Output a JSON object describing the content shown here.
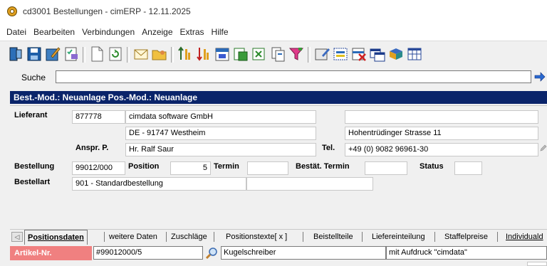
{
  "window": {
    "title": "cd3001 Bestellungen - cimERP - 12.11.2025"
  },
  "menu": [
    "Datei",
    "Bearbeiten",
    "Verbindungen",
    "Anzeige",
    "Extras",
    "Hilfe"
  ],
  "search": {
    "label": "Suche",
    "value": ""
  },
  "mode_bar": "Best.-Mod.: Neuanlage Pos.-Mod.: Neuanlage",
  "form": {
    "lieferant_label": "Lieferant",
    "lieferant_nr": "877778",
    "lieferant_name": "cimdata software GmbH",
    "lieferant_ort": "DE - 91747 Westheim",
    "lieferant_zusatz": "",
    "lieferant_strasse": "Hohentrüdinger Strasse 11",
    "ansprech_label": "Anspr. P.",
    "ansprech_value": "Hr. Ralf Saur",
    "tel_label": "Tel.",
    "tel_value": "+49 (0) 9082 96961-30",
    "bestellung_label": "Bestellung",
    "bestellung_value": "99012/000",
    "position_label": "Position",
    "position_value": "5",
    "termin_label": "Termin",
    "termin_value": "",
    "bestaet_label": "Bestät. Termin",
    "bestaet_value": "",
    "status_label": "Status",
    "status_value": "",
    "bestellart_label": "Bestellart",
    "bestellart_value": "901 - Standardbestellung",
    "bestellart_extra": ""
  },
  "tabs": [
    "Positionsdaten",
    "weitere Daten",
    "Zuschläge",
    "Positionstexte[ x ]",
    "Beistellteile",
    "Liefereinteilung",
    "Staffelpreise",
    "Individuald"
  ],
  "article": {
    "label": "Artikel-Nr.",
    "number": "#99012000/5",
    "name": "Kugelschreiber",
    "note": "mit Aufdruck \"cimdata\""
  }
}
